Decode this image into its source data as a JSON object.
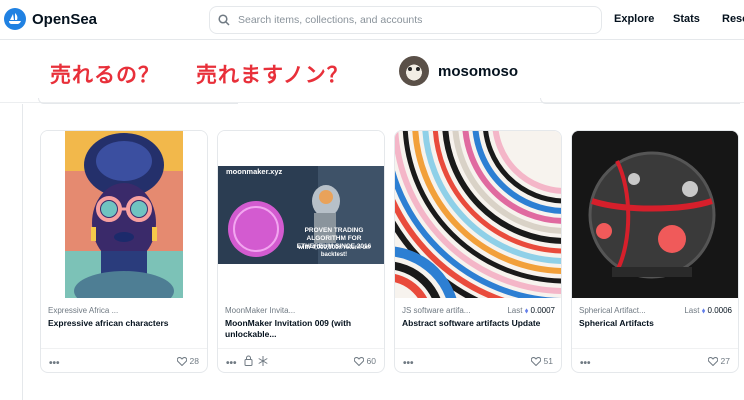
{
  "header": {
    "logo_text": "OpenSea",
    "search_placeholder": "Search items, collections, and accounts",
    "nav": [
      "Explore",
      "Stats",
      "Reso"
    ]
  },
  "banner": {
    "jp_text_1": "売れるの？",
    "jp_text_2": "売れますノン？",
    "username": "mosomoso"
  },
  "cards": [
    {
      "collection": "Expressive Africa ...",
      "name": "Expressive african characters",
      "last_label": "",
      "last_price": "",
      "likes": "28"
    },
    {
      "collection": "MoonMaker Invita...",
      "name": "MoonMaker Invitation 009 (with unlockable...",
      "last_label": "",
      "last_price": "",
      "likes": "60",
      "image_text_top": "moonmaker.xyz",
      "image_text_main": "PROVEN TRADING ALGORITHM FOR ETHEREUM SINCE 2016",
      "image_text_sub": "with 4,000,000x return on backtest!"
    },
    {
      "collection": "JS software artifa...",
      "name": "Abstract software artifacts Update",
      "last_label": "Last",
      "last_price": "0.0007",
      "likes": "51"
    },
    {
      "collection": "Spherical Artifact...",
      "name": "Spherical Artifacts",
      "last_label": "Last",
      "last_price": "0.0006",
      "likes": "27"
    }
  ],
  "colors": {
    "brand": "#2081e2",
    "accent_text": "#e8303a"
  }
}
